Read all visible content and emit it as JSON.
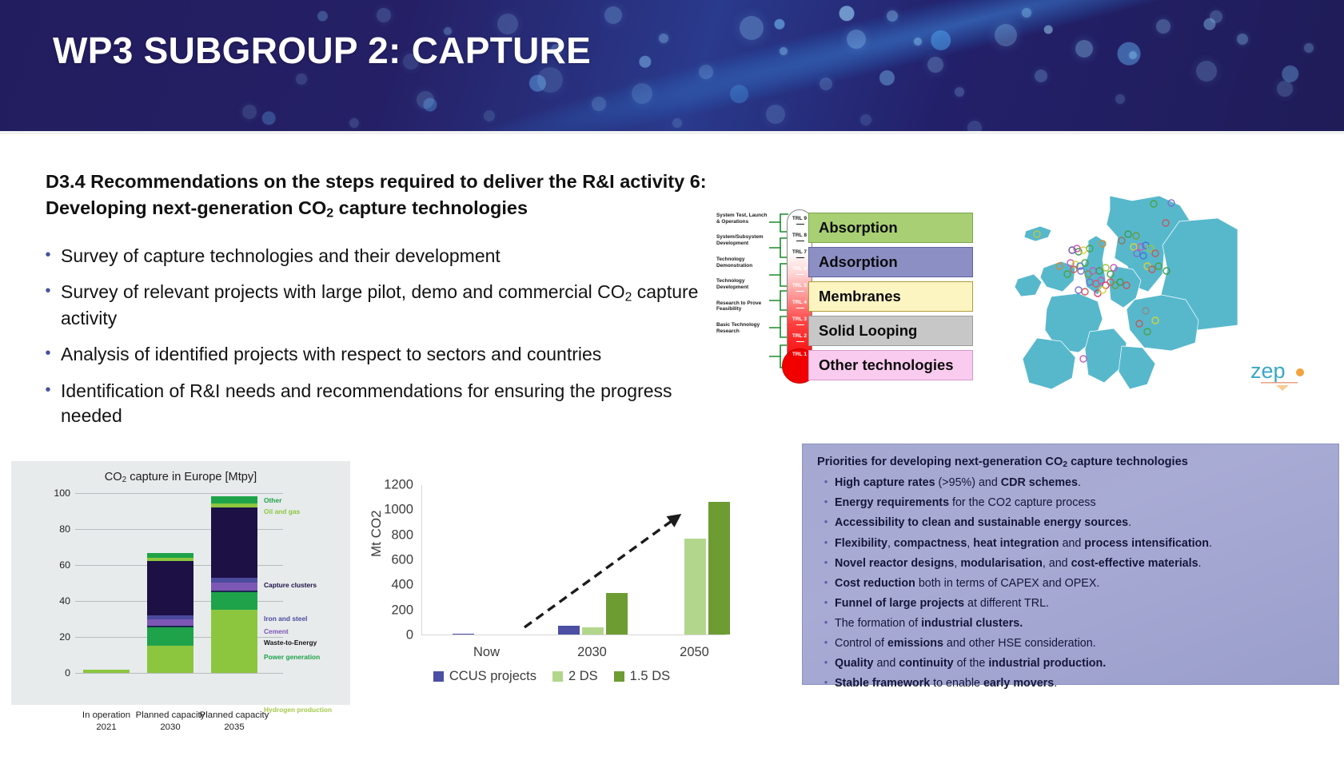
{
  "banner": {
    "title": "WP3 SUBGROUP 2: CAPTURE"
  },
  "headline": {
    "line1": "D3.4 Recommendations on the steps required to deliver the R&I activity 6:",
    "line2_a": "Developing next-generation CO",
    "line2_sub": "2",
    "line2_b": " capture technologies"
  },
  "bullets": [
    {
      "text": "Survey of capture technologies and their development",
      "sub": null
    },
    {
      "a": "Survey of relevant projects with large pilot, demo and commercial CO",
      "sub": "2",
      "b": " capture activity"
    },
    {
      "text": "Analysis of identified projects with respect to sectors and countries",
      "sub": null
    },
    {
      "text": "Identification of R&I needs and recommendations for ensuring the progress needed",
      "sub": null
    }
  ],
  "trl": {
    "stage_labels": [
      "System Test, Launch & Operations",
      "System/Subsystem Development",
      "Technology Demonstration",
      "Technology Development",
      "Research to Prove Feasibility",
      "Basic Technology Research"
    ],
    "levels": [
      "TRL 9",
      "TRL 8",
      "TRL 7",
      "TRL 6",
      "TRL 5",
      "TRL 4",
      "TRL 3",
      "TRL 2",
      "TRL 1"
    ]
  },
  "tech_boxes": [
    {
      "label": "Absorption",
      "fill": "#a8cf74",
      "border": "#7aa64c"
    },
    {
      "label": "Adsorption",
      "fill": "#8b8fc4",
      "border": "#5f63a0"
    },
    {
      "label": "Membranes",
      "fill": "#fcf4c1",
      "border": "#b09c3a"
    },
    {
      "label": "Solid Looping",
      "fill": "#c7c7c7",
      "border": "#9a9a9a"
    },
    {
      "label": "Other technologies",
      "fill": "#f9cbee",
      "border": "#d79ac8"
    }
  ],
  "logo": {
    "text": "zep"
  },
  "priorities": {
    "title_a": "Priorities for developing next-generation CO",
    "title_sub": "2",
    "title_b": " capture technologies",
    "items": [
      [
        {
          "t": "High capture rates",
          "b": true
        },
        {
          "t": " (>95%) and ",
          "b": false
        },
        {
          "t": "CDR schemes",
          "b": true
        },
        {
          "t": ".",
          "b": false
        }
      ],
      [
        {
          "t": "Energy requirements",
          "b": true
        },
        {
          "t": " for the CO2 capture process",
          "b": false
        }
      ],
      [
        {
          "t": "Accessibility to clean and sustainable energy sources",
          "b": true
        },
        {
          "t": ".",
          "b": false
        }
      ],
      [
        {
          "t": "Flexibility",
          "b": true
        },
        {
          "t": ", ",
          "b": false
        },
        {
          "t": "compactness",
          "b": true
        },
        {
          "t": ", ",
          "b": false
        },
        {
          "t": "heat integration",
          "b": true
        },
        {
          "t": " and ",
          "b": false
        },
        {
          "t": "process intensification",
          "b": true
        },
        {
          "t": ".",
          "b": false
        }
      ],
      [
        {
          "t": "Novel reactor designs",
          "b": true
        },
        {
          "t": ", ",
          "b": false
        },
        {
          "t": "modularisation",
          "b": true
        },
        {
          "t": ", and ",
          "b": false
        },
        {
          "t": "cost-effective materials",
          "b": true
        },
        {
          "t": ".",
          "b": false
        }
      ],
      [
        {
          "t": "Cost reduction",
          "b": true
        },
        {
          "t": " both in terms of CAPEX and OPEX.",
          "b": false
        }
      ],
      [
        {
          "t": "Funnel of large projects",
          "b": true
        },
        {
          "t": " at different TRL.",
          "b": false
        }
      ],
      [
        {
          "t": "The formation of ",
          "b": false
        },
        {
          "t": "industrial clusters.",
          "b": true
        }
      ],
      [
        {
          "t": "Control of ",
          "b": false
        },
        {
          "t": "emissions",
          "b": true
        },
        {
          "t": " and other HSE consideration.",
          "b": false
        }
      ],
      [
        {
          "t": "Quality",
          "b": true
        },
        {
          "t": " and ",
          "b": false
        },
        {
          "t": "continuity",
          "b": true
        },
        {
          "t": " of the ",
          "b": false
        },
        {
          "t": "industrial production.",
          "b": true
        }
      ],
      [
        {
          "t": "Stable framework",
          "b": true
        },
        {
          "t": " to enable ",
          "b": false
        },
        {
          "t": "early movers",
          "b": true
        },
        {
          "t": ".",
          "b": false
        }
      ]
    ]
  },
  "chart_data": [
    {
      "type": "bar",
      "id": "co2-capture-europe",
      "title_a": "CO",
      "title_sub": "2",
      "title_b": " capture in Europe  [Mtpy]",
      "stacked": true,
      "categories": [
        "In operation 2021",
        "Planned capacity 2030",
        "Planned capacity 2035"
      ],
      "category_lines": [
        [
          "In operation",
          "2021"
        ],
        [
          "Planned capacity",
          "2030"
        ],
        [
          "Planned capacity",
          "2035"
        ]
      ],
      "ylim": [
        0,
        100
      ],
      "yticks": [
        0,
        20,
        40,
        60,
        80,
        100
      ],
      "ylabel": "",
      "xlabel": "",
      "grid": true,
      "series": [
        {
          "name": "Hydrogen production",
          "color": "#8cc63f",
          "values": [
            1.8,
            15.0,
            35.0
          ]
        },
        {
          "name": "Power generation",
          "color": "#1fa34a",
          "values": [
            0,
            10.5,
            10.0
          ]
        },
        {
          "name": "Waste-to-Energy",
          "color": "#1b2a4e",
          "values": [
            0,
            0.8,
            1.0
          ]
        },
        {
          "name": "Cement",
          "color": "#7d57b5",
          "values": [
            0,
            3.4,
            4.2
          ]
        },
        {
          "name": "Iron and steel",
          "color": "#4a4a9e",
          "values": [
            0,
            2.4,
            2.5
          ]
        },
        {
          "name": "Capture clusters",
          "color": "#1d1045",
          "values": [
            0,
            30.0,
            39.5
          ]
        },
        {
          "name": "Oil and gas",
          "color": "#8cc63f",
          "values": [
            0,
            2.0,
            2.0
          ]
        },
        {
          "name": "Other",
          "color": "#1fa34a",
          "values": [
            0,
            2.8,
            4.0
          ]
        }
      ],
      "legend_position": "right-inline",
      "legend_entries": [
        {
          "label": "Other",
          "color": "#1fa34a"
        },
        {
          "label": "Oil and gas",
          "color": "#8cc63f"
        },
        {
          "label": "Capture clusters",
          "color": "#1d1045"
        },
        {
          "label": "Iron and steel",
          "color": "#4a4a9e"
        },
        {
          "label": "Cement",
          "color": "#7d57b5"
        },
        {
          "label": "Waste-to-Energy",
          "color": "#141414"
        },
        {
          "label": "Power generation",
          "color": "#1fa34a"
        },
        {
          "label": "Hydrogen production",
          "color": "#a5c94a"
        }
      ]
    },
    {
      "type": "bar",
      "id": "mt-co2-scenarios",
      "title": "",
      "categories": [
        "Now",
        "2030",
        "2050"
      ],
      "ylabel": "Mt CO2",
      "xlabel": "",
      "ylim": [
        0,
        1200
      ],
      "yticks": [
        0,
        200,
        400,
        600,
        800,
        1000,
        1200
      ],
      "grid": false,
      "annotation": "dashed growth arrow from Now to 2050",
      "series": [
        {
          "name": "CCUS projects",
          "color": "#4c4fa3",
          "values": [
            3,
            70,
            0
          ]
        },
        {
          "name": "2 DS",
          "color": "#b2d78c",
          "values": [
            0,
            60,
            765
          ]
        },
        {
          "name": "1.5 DS",
          "color": "#6d9c33",
          "values": [
            0,
            330,
            1060
          ]
        }
      ],
      "legend_position": "bottom",
      "legend_entries": [
        {
          "label": "CCUS projects",
          "color": "#4c4fa3"
        },
        {
          "label": "2 DS",
          "color": "#b2d78c"
        },
        {
          "label": "1.5 DS",
          "color": "#6d9c33"
        }
      ]
    }
  ]
}
